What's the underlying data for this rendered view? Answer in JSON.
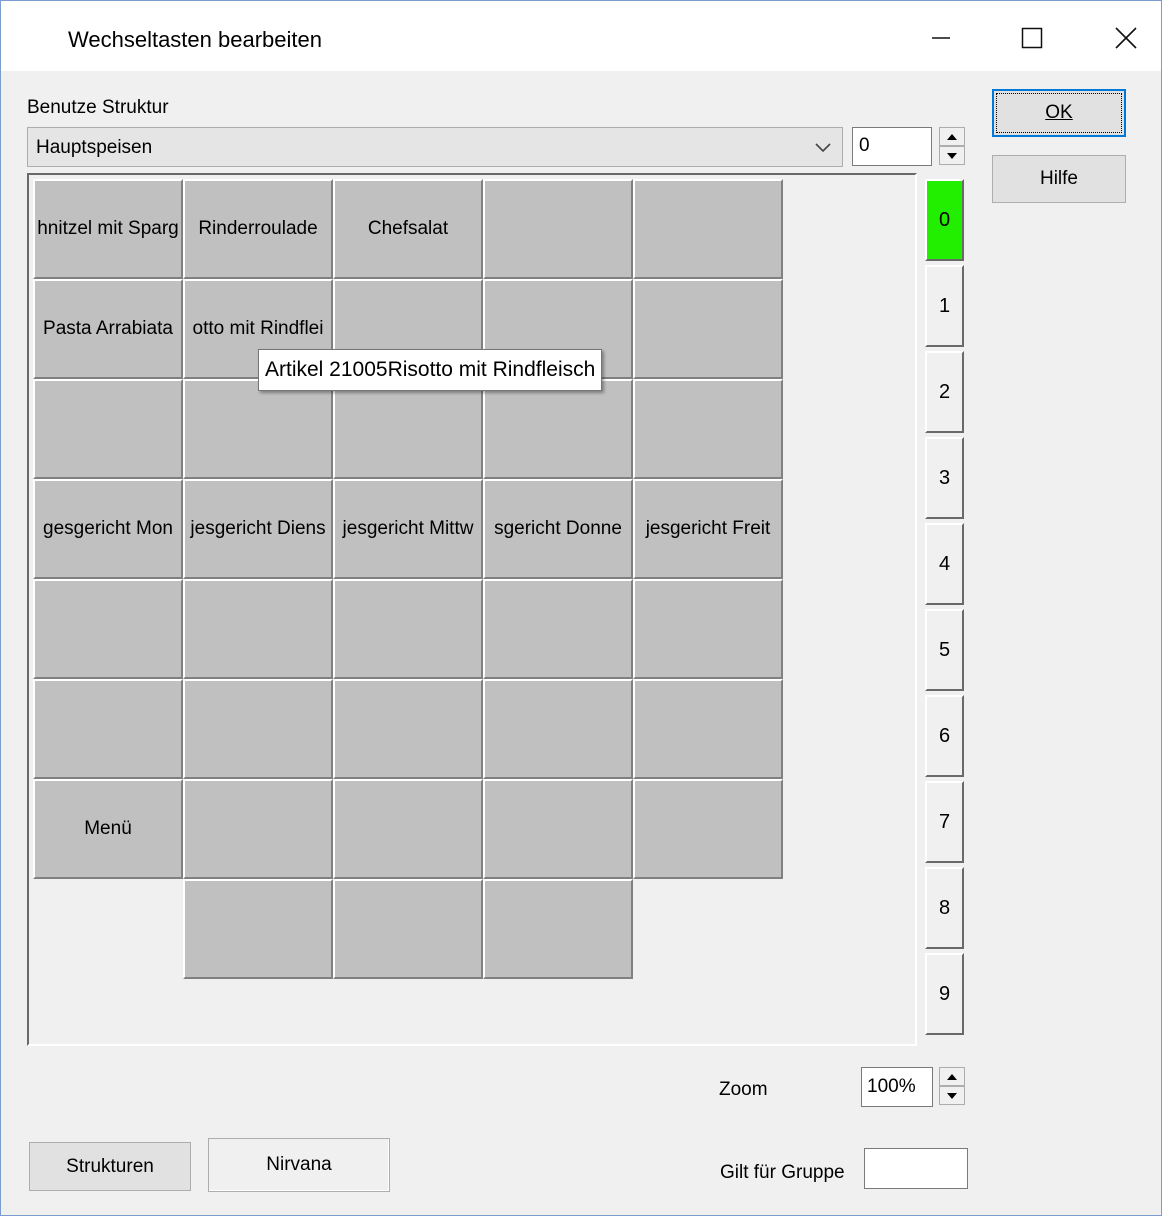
{
  "window": {
    "title": "Wechseltasten bearbeiten"
  },
  "structure": {
    "label": "Benutze Struktur",
    "selected": "Hauptspeisen",
    "level_value": "0"
  },
  "grid": {
    "rows": [
      [
        "hnitzel mit Sparg",
        "Rinderroulade",
        "Chefsalat",
        "",
        ""
      ],
      [
        "Pasta Arrabiata",
        "otto mit Rindflei",
        "",
        "",
        ""
      ],
      [
        "",
        "",
        "",
        "",
        ""
      ],
      [
        "gesgericht Mon",
        "jesgericht Diens",
        "jesgericht Mittw",
        "sgericht Donne",
        "jesgericht Freit"
      ],
      [
        "",
        "",
        "",
        "",
        ""
      ],
      [
        "",
        "",
        "",
        "",
        ""
      ],
      [
        "Menü",
        "",
        "",
        "",
        ""
      ],
      [
        "",
        "",
        ""
      ]
    ]
  },
  "tooltip": {
    "text": "Artikel 21005Risotto mit Rindfleisch"
  },
  "layers": [
    "0",
    "1",
    "2",
    "3",
    "4",
    "5",
    "6",
    "7",
    "8",
    "9"
  ],
  "active_layer": "0",
  "buttons": {
    "ok": "OK",
    "hilfe": "Hilfe",
    "strukturen": "Strukturen",
    "nirvana": "Nirvana"
  },
  "zoom": {
    "label": "Zoom",
    "value": "100%"
  },
  "gruppe": {
    "label": "Gilt für Gruppe",
    "value": ""
  },
  "colors": {
    "active_layer": "#22ee00",
    "key_face": "#c0c0c0",
    "accent": "#0078d7"
  }
}
